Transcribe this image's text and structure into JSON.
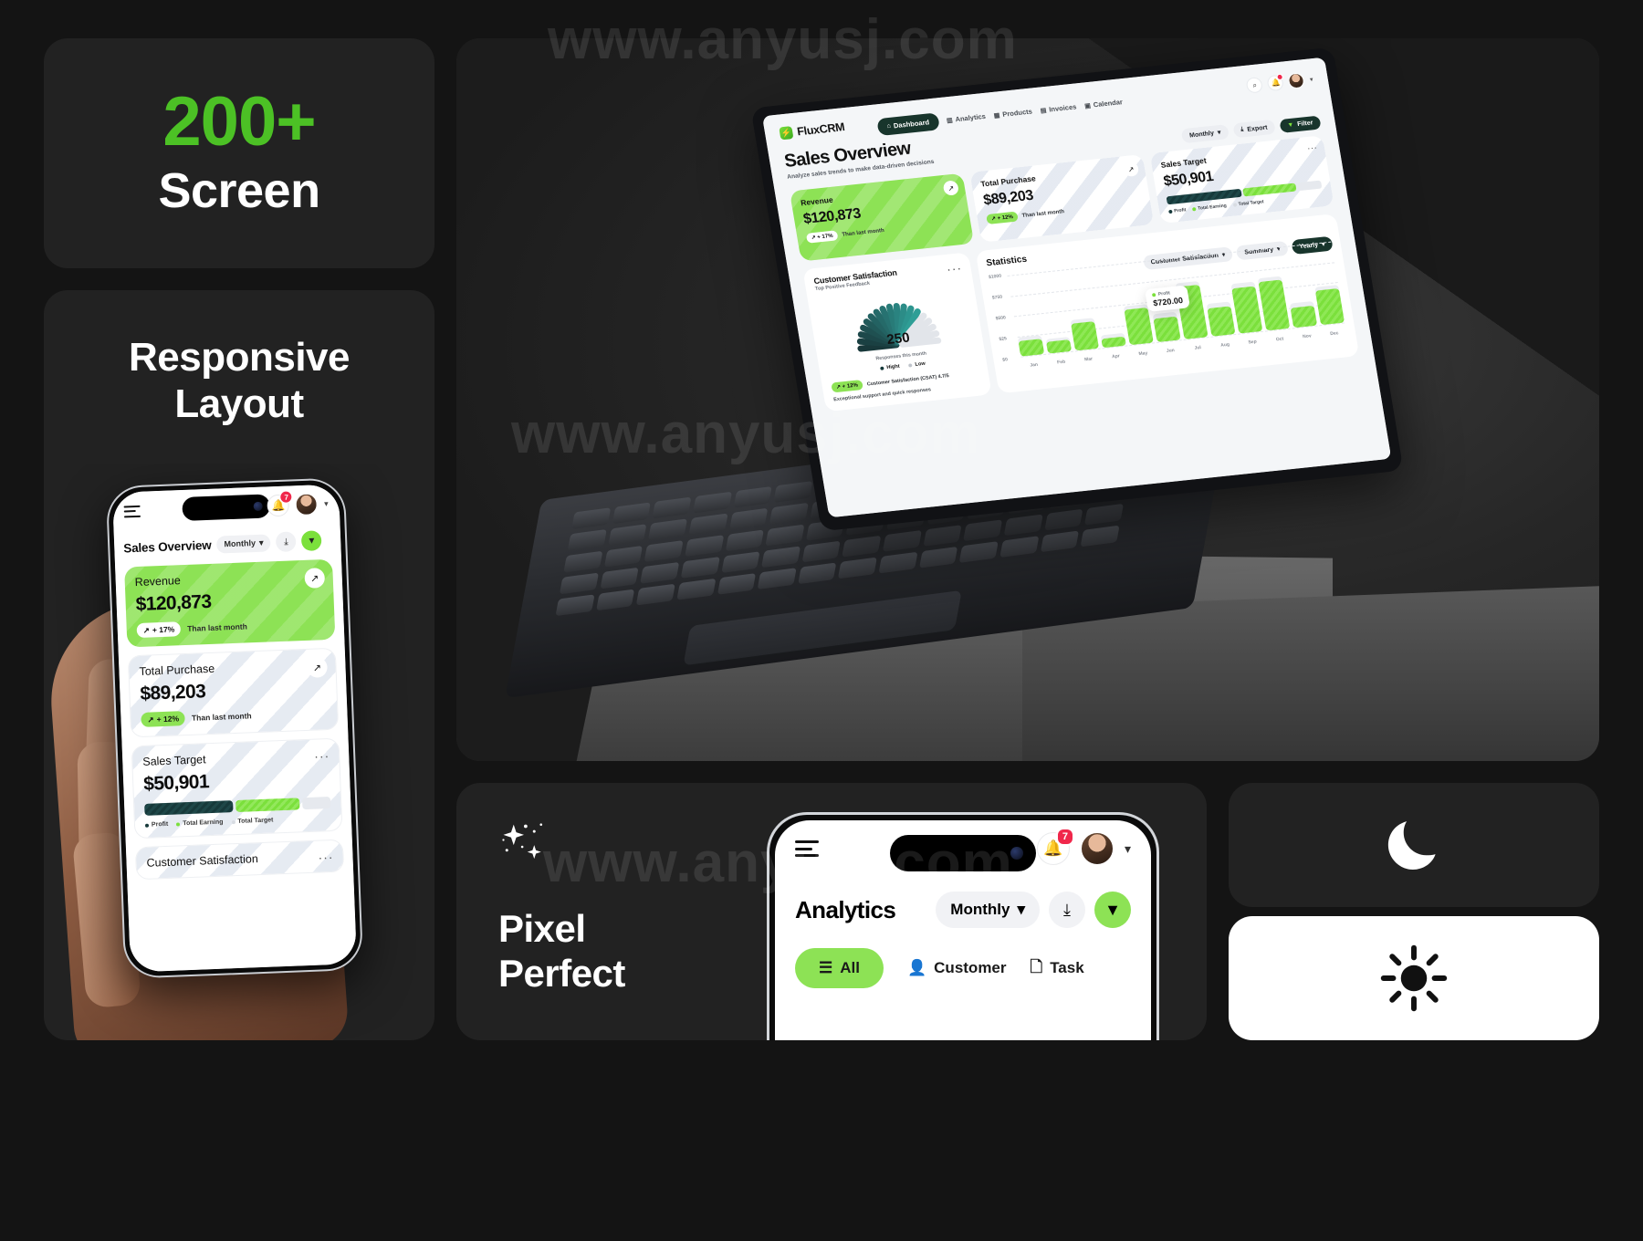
{
  "panels": {
    "screens": {
      "count": "200+",
      "label": "Screen"
    },
    "responsive": {
      "title_line1": "Responsive",
      "title_line2": "Layout"
    },
    "pixel": {
      "title_line1": "Pixel",
      "title_line2": "Perfect",
      "sparkle_icon": "sparkle-icon"
    },
    "theme": {
      "moon_icon": "moon-icon",
      "sun_icon": "sun-icon"
    }
  },
  "watermarks": {
    "top": "www.anyusj.com",
    "middle": "www.anyusj.com",
    "bottom": "www.anyusj.com"
  },
  "dashboard": {
    "brand": "FluxCRM",
    "brand_icon": "bolt-icon",
    "page_title": "Sales Overview",
    "page_subtitle": "Analyze sales trends to make data-driven decisions",
    "nav": [
      {
        "label": "Dashboard",
        "icon": "home-icon",
        "active": true
      },
      {
        "label": "Analytics",
        "icon": "bar-chart-icon",
        "active": false
      },
      {
        "label": "Products",
        "icon": "grid-icon",
        "active": false
      },
      {
        "label": "Invoices",
        "icon": "invoice-icon",
        "active": false
      },
      {
        "label": "Calendar",
        "icon": "calendar-icon",
        "active": false
      }
    ],
    "tools": [
      {
        "name": "search-icon",
        "glyph": "⌕"
      },
      {
        "name": "notification-bell-icon",
        "glyph": "⌁"
      },
      {
        "name": "avatar",
        "glyph": ""
      }
    ],
    "actions": {
      "period": "Monthly",
      "export": "Export",
      "export_icon": "download-icon",
      "filter": "Filter",
      "filter_icon": "funnel-icon",
      "chevron": "chevron-down-icon"
    },
    "kpis": [
      {
        "title": "Revenue",
        "value": "$120,873",
        "delta": "+ 17%",
        "note": "Than last month",
        "style": "green",
        "corner": "arrow-up-right-icon"
      },
      {
        "title": "Total Purchase",
        "value": "$89,203",
        "delta": "+ 12%",
        "note": "Than last month",
        "style": "white",
        "corner": "arrow-up-right-icon"
      },
      {
        "title": "Sales Target",
        "value": "$50,901",
        "style": "white",
        "corner": "more-dots-icon",
        "legend": [
          "Profit",
          "Total Earning",
          "Total Target"
        ]
      }
    ],
    "csat": {
      "title": "Customer Satisfaction",
      "subtitle": "Top Positive Feedback",
      "value": "250",
      "value_label": "Responses this month",
      "legend": [
        "Hight",
        "Low"
      ],
      "delta": "+ 12%",
      "score_line": "Customer Satisfaction (CSAT) 4.7/5",
      "footer": "Exceptional support and quick responses",
      "more_icon": "more-dots-icon"
    },
    "statistics": {
      "title": "Statistics",
      "controls": [
        {
          "label": "Customer Satisfaction",
          "icon": "chevron-down-icon"
        },
        {
          "label": "Summary",
          "icon": "chevron-down-icon"
        },
        {
          "label": "Yearly",
          "icon": "chevron-down-icon",
          "style": "dark"
        }
      ],
      "tooltip": {
        "label": "Profit",
        "value": "$720.00"
      }
    }
  },
  "chart_data": {
    "type": "bar",
    "title": "Statistics",
    "xlabel": "",
    "ylabel": "",
    "categories": [
      "Jan",
      "Feb",
      "Mar",
      "Apr",
      "May",
      "Jun",
      "Jul",
      "Aug",
      "Sep",
      "Oct",
      "Nov",
      "Dec"
    ],
    "values": [
      190,
      140,
      330,
      110,
      430,
      290,
      640,
      350,
      560,
      600,
      250,
      420
    ],
    "track_values": [
      235,
      180,
      375,
      155,
      480,
      340,
      690,
      400,
      610,
      650,
      300,
      470
    ],
    "ytick_labels": [
      "$1000",
      "$750",
      "$500",
      "$25",
      "$0"
    ],
    "ytick_values": [
      1000,
      750,
      500,
      250,
      0
    ],
    "ylim": [
      0,
      1000
    ],
    "grid": true,
    "legend": [
      "Profit"
    ],
    "annotation": {
      "category": "Jun",
      "label": "Profit",
      "value": "$720.00"
    },
    "series": [
      {
        "name": "Profit",
        "values": [
          190,
          140,
          330,
          110,
          430,
          290,
          640,
          350,
          560,
          600,
          250,
          420
        ]
      }
    ]
  },
  "phone_left": {
    "notification_count": "7",
    "hamburger_icon": "menu-icon",
    "bell_icon": "bell-icon",
    "avatar_icon": "avatar",
    "chevron_icon": "chevron-down-icon",
    "title": "Sales Overview",
    "period": "Monthly",
    "export_icon": "download-icon",
    "filter_icon": "funnel-icon",
    "cards": [
      {
        "title": "Revenue",
        "value": "$120,873",
        "delta": "+ 17%",
        "note": "Than last month",
        "style": "green",
        "corner": "arrow-up-right-icon"
      },
      {
        "title": "Total Purchase",
        "value": "$89,203",
        "delta": "+ 12%",
        "note": "Than last month",
        "style": "white",
        "corner": "arrow-up-right-icon"
      },
      {
        "title": "Sales Target",
        "value": "$50,901",
        "style": "white",
        "corner": "more-dots-icon",
        "legend": [
          "Profit",
          "Total Earning",
          "Total Target"
        ]
      }
    ],
    "next_card_title": "Customer Satisfaction"
  },
  "phone_bottom": {
    "notification_count": "7",
    "hamburger_icon": "menu-icon",
    "bell_icon": "bell-icon",
    "avatar_icon": "avatar",
    "chevron_icon": "chevron-down-icon",
    "title": "Analytics",
    "period": "Monthly",
    "export_icon": "download-icon",
    "filter_icon": "funnel-icon",
    "tabs": [
      {
        "label": "All",
        "icon": "list-icon",
        "active": true
      },
      {
        "label": "Customer",
        "icon": "user-icon",
        "active": false
      },
      {
        "label": "Task",
        "icon": "file-icon",
        "active": false
      }
    ]
  },
  "colors": {
    "accent_green": "#8DE255",
    "bright_green": "#4CC125",
    "dark_green": "#18352C",
    "panel_bg": "#222222",
    "page_bg": "#141414",
    "badge_red": "#F0274B"
  }
}
